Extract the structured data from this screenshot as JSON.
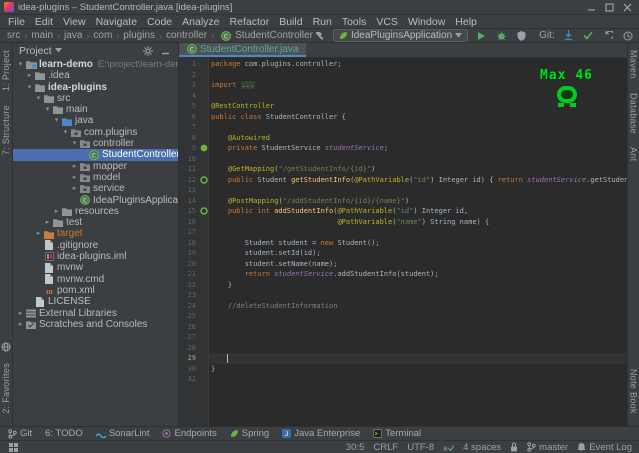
{
  "colors": {
    "panel_bg": "#3c3f41",
    "editor_bg": "#2b2b2b",
    "selection_blue": "#4b6eaf",
    "tab_underline_blue": "#4a88c7",
    "keyword_orange": "#cc7832",
    "annotation_yellow": "#bbb529",
    "string_green": "#6a8759",
    "method_yellow": "#ffc66d",
    "field_purple": "#9876aa",
    "comment_gray": "#808080",
    "overlay_green": "#00dd22",
    "excluded_orange": "#cc7832"
  },
  "window": {
    "title": "idea-plugins – StudentController.java [idea-plugins]"
  },
  "menu": [
    "File",
    "Edit",
    "View",
    "Navigate",
    "Code",
    "Analyze",
    "Refactor",
    "Build",
    "Run",
    "Tools",
    "VCS",
    "Window",
    "Help"
  ],
  "navbar": {
    "breadcrumbs": [
      "src",
      "main",
      "java",
      "com",
      "plugins",
      "controller"
    ],
    "file": "StudentController",
    "run_config": "IdeaPluginsApplication",
    "git_label": "Git:"
  },
  "left_stripe": {
    "top": [
      "1: Project",
      "7: Structure"
    ],
    "bottom": [
      "2: Favorites"
    ]
  },
  "right_stripe": {
    "top": [
      "Maven",
      "Database",
      "Ant"
    ],
    "bottom": [
      "Note Book"
    ]
  },
  "project_panel": {
    "title": "Project",
    "tree": [
      {
        "label": "learn-demo",
        "extra": "E:\\project\\learn-demo",
        "icon": "project",
        "level": 0,
        "arrow": "down",
        "bold": true
      },
      {
        "label": ".idea",
        "icon": "folder",
        "level": 1,
        "arrow": "right"
      },
      {
        "label": "idea-plugins",
        "icon": "folder",
        "level": 1,
        "arrow": "down",
        "bold": true
      },
      {
        "label": "src",
        "icon": "folder",
        "level": 2,
        "arrow": "down"
      },
      {
        "label": "main",
        "icon": "folder",
        "level": 3,
        "arrow": "down"
      },
      {
        "label": "java",
        "icon": "folder-src",
        "level": 4,
        "arrow": "down"
      },
      {
        "label": "com.plugins",
        "icon": "package",
        "level": 5,
        "arrow": "down"
      },
      {
        "label": "controller",
        "icon": "package",
        "level": 6,
        "arrow": "down"
      },
      {
        "label": "StudentController",
        "icon": "class",
        "level": 7,
        "arrow": "none",
        "selected": true
      },
      {
        "label": "mapper",
        "icon": "package",
        "level": 6,
        "arrow": "right"
      },
      {
        "label": "model",
        "icon": "package",
        "level": 6,
        "arrow": "right"
      },
      {
        "label": "service",
        "icon": "package",
        "level": 6,
        "arrow": "right"
      },
      {
        "label": "IdeaPluginsApplication",
        "icon": "class",
        "level": 6,
        "arrow": "none"
      },
      {
        "label": "resources",
        "icon": "folder",
        "level": 4,
        "arrow": "right"
      },
      {
        "label": "test",
        "icon": "folder",
        "level": 3,
        "arrow": "right"
      },
      {
        "label": "target",
        "icon": "folder-excluded",
        "level": 2,
        "arrow": "right",
        "color": "#cc7832"
      },
      {
        "label": ".gitignore",
        "icon": "file",
        "level": 2,
        "arrow": "none"
      },
      {
        "label": "idea-plugins.iml",
        "icon": "iml",
        "level": 2,
        "arrow": "none"
      },
      {
        "label": "mvnw",
        "icon": "file",
        "level": 2,
        "arrow": "none"
      },
      {
        "label": "mvnw.cmd",
        "icon": "file",
        "level": 2,
        "arrow": "none"
      },
      {
        "label": "pom.xml",
        "icon": "maven",
        "level": 2,
        "arrow": "none"
      },
      {
        "label": "LICENSE",
        "icon": "file",
        "level": 1,
        "arrow": "none"
      },
      {
        "label": "External Libraries",
        "icon": "libs",
        "level": 0,
        "arrow": "right"
      },
      {
        "label": "Scratches and Consoles",
        "icon": "scratches",
        "level": 0,
        "arrow": "right"
      }
    ]
  },
  "editor": {
    "tab": "StudentController.java",
    "overlay_text": "Max 46",
    "lines": [
      {
        "num": 1,
        "seg": [
          {
            "c": "kw",
            "t": "package "
          },
          {
            "c": "pl",
            "t": "com.plugins.controller;"
          }
        ]
      },
      {
        "num": 2,
        "seg": []
      },
      {
        "num": 3,
        "seg": [
          {
            "c": "kw",
            "t": "import "
          },
          {
            "c": "fold",
            "t": "..."
          }
        ]
      },
      {
        "num": 4,
        "seg": []
      },
      {
        "num": 5,
        "seg": [
          {
            "c": "ann",
            "t": "@RestController"
          }
        ]
      },
      {
        "num": 6,
        "seg": [
          {
            "c": "kw",
            "t": "public class "
          },
          {
            "c": "pl",
            "t": "StudentController {"
          }
        ]
      },
      {
        "num": 7,
        "seg": []
      },
      {
        "num": 8,
        "seg": [
          {
            "c": "pl",
            "t": "    "
          },
          {
            "c": "ann",
            "t": "@Autowired"
          }
        ]
      },
      {
        "num": 9,
        "gutter": "bean",
        "seg": [
          {
            "c": "pl",
            "t": "    "
          },
          {
            "c": "kw",
            "t": "private "
          },
          {
            "c": "pl",
            "t": "StudentService "
          },
          {
            "c": "fld",
            "t": "studentService"
          },
          {
            "c": "pl",
            "t": ";"
          }
        ]
      },
      {
        "num": 10,
        "seg": []
      },
      {
        "num": 11,
        "seg": [
          {
            "c": "pl",
            "t": "    "
          },
          {
            "c": "ann",
            "t": "@GetMapping"
          },
          {
            "c": "pl",
            "t": "("
          },
          {
            "c": "str",
            "t": "\"/getStudentInfo/{id}\""
          },
          {
            "c": "pl",
            "t": ")"
          }
        ]
      },
      {
        "num": 12,
        "gutter": "mapping",
        "seg": [
          {
            "c": "pl",
            "t": "    "
          },
          {
            "c": "kw",
            "t": "public "
          },
          {
            "c": "pl",
            "t": "Student "
          },
          {
            "c": "mth",
            "t": "getStudentInfo"
          },
          {
            "c": "pl",
            "t": "("
          },
          {
            "c": "ann",
            "t": "@PathVariable"
          },
          {
            "c": "pl",
            "t": "("
          },
          {
            "c": "str",
            "t": "\"id\""
          },
          {
            "c": "pl",
            "t": ") Integer id) { "
          },
          {
            "c": "kw",
            "t": "return "
          },
          {
            "c": "fld",
            "t": "studentService"
          },
          {
            "c": "pl",
            "t": ".getStudent"
          }
        ]
      },
      {
        "num": 13,
        "seg": []
      },
      {
        "num": 14,
        "seg": [
          {
            "c": "pl",
            "t": "    "
          },
          {
            "c": "ann",
            "t": "@PostMapping"
          },
          {
            "c": "pl",
            "t": "("
          },
          {
            "c": "str",
            "t": "\"/addStudentInfo/{id}/{name}\""
          },
          {
            "c": "pl",
            "t": ")"
          }
        ]
      },
      {
        "num": 15,
        "gutter": "mapping",
        "seg": [
          {
            "c": "pl",
            "t": "    "
          },
          {
            "c": "kw",
            "t": "public int "
          },
          {
            "c": "mth",
            "t": "addStudentInfo"
          },
          {
            "c": "pl",
            "t": "("
          },
          {
            "c": "ann",
            "t": "@PathVariable"
          },
          {
            "c": "pl",
            "t": "("
          },
          {
            "c": "str",
            "t": "\"id\""
          },
          {
            "c": "pl",
            "t": ") Integer id,"
          }
        ]
      },
      {
        "num": 16,
        "seg": [
          {
            "c": "pl",
            "t": "                              "
          },
          {
            "c": "ann",
            "t": "@PathVariable"
          },
          {
            "c": "pl",
            "t": "("
          },
          {
            "c": "str",
            "t": "\"name\""
          },
          {
            "c": "pl",
            "t": ") String name) {"
          }
        ]
      },
      {
        "num": 17,
        "seg": []
      },
      {
        "num": 18,
        "seg": [
          {
            "c": "pl",
            "t": "        Student student = "
          },
          {
            "c": "kw",
            "t": "new "
          },
          {
            "c": "pl",
            "t": "Student();"
          }
        ]
      },
      {
        "num": 19,
        "seg": [
          {
            "c": "pl",
            "t": "        student.setId(id);"
          }
        ]
      },
      {
        "num": 20,
        "seg": [
          {
            "c": "pl",
            "t": "        student.setName(name);"
          }
        ]
      },
      {
        "num": 21,
        "seg": [
          {
            "c": "pl",
            "t": "        "
          },
          {
            "c": "kw",
            "t": "return "
          },
          {
            "c": "fld",
            "t": "studentService"
          },
          {
            "c": "pl",
            "t": ".addStudentInfo(student);"
          }
        ]
      },
      {
        "num": 22,
        "seg": [
          {
            "c": "pl",
            "t": "    }"
          }
        ]
      },
      {
        "num": 23,
        "seg": []
      },
      {
        "num": 24,
        "seg": [
          {
            "c": "cmt",
            "t": "    //deleteStudentInformation"
          }
        ]
      },
      {
        "num": 25,
        "seg": []
      },
      {
        "num": 26,
        "seg": []
      },
      {
        "num": 27,
        "seg": []
      },
      {
        "num": 28,
        "seg": []
      },
      {
        "num": 29,
        "caret": true,
        "seg": []
      },
      {
        "num": 30,
        "seg": [
          {
            "c": "pl",
            "t": "}"
          }
        ]
      },
      {
        "num": 31,
        "seg": []
      }
    ]
  },
  "bottom_bar": {
    "items": [
      {
        "label": "Git",
        "icon": "git-branch"
      },
      {
        "label": "6: TODO",
        "icon": null
      },
      {
        "label": "SonarLint",
        "icon": "sonarlint"
      },
      {
        "label": "Endpoints",
        "icon": "endpoints"
      },
      {
        "label": "Spring",
        "icon": "spring"
      },
      {
        "label": "Java Enterprise",
        "icon": "java-ee"
      },
      {
        "label": "Terminal",
        "icon": "terminal"
      }
    ]
  },
  "status_bar": {
    "items": [
      {
        "name": "caret-position",
        "label": "30:5"
      },
      {
        "name": "line-separator",
        "label": "CRLF"
      },
      {
        "name": "encoding",
        "label": "UTF-8"
      },
      {
        "name": "spellcheck",
        "icon": "spellcheck"
      },
      {
        "name": "indent",
        "label": "4 spaces"
      },
      {
        "name": "readonly-toggle",
        "icon": "lock"
      },
      {
        "name": "git-branch",
        "icon": "git-branch",
        "label": "master"
      },
      {
        "name": "event-log",
        "icon": "bell",
        "label": "Event Log"
      }
    ]
  }
}
